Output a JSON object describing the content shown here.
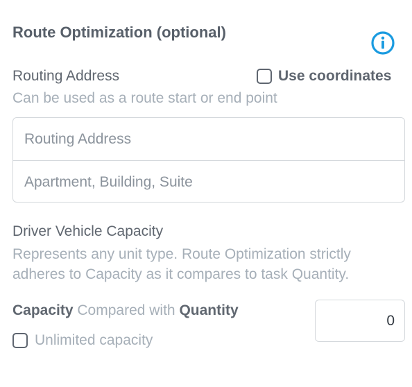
{
  "section": {
    "title": "Route Optimization (optional)",
    "info_icon": "info-circle-icon",
    "accent_color": "#1a9be0"
  },
  "routing": {
    "label": "Routing Address",
    "hint": "Can be used as a route start or end point",
    "use_coordinates_label": "Use coordinates",
    "use_coordinates_checked": false,
    "address_placeholder": "Routing Address",
    "address_value": "",
    "suite_placeholder": "Apartment, Building, Suite",
    "suite_value": ""
  },
  "capacity": {
    "label": "Driver Vehicle Capacity",
    "hint_line1": "Represents any unit type. Route Optimization strictly",
    "hint_line2": "adheres to Capacity as it compares to task Quantity.",
    "compare_bold1": "Capacity",
    "compare_middle": " Compared with ",
    "compare_bold2": "Quantity",
    "value": "0",
    "unlimited_label": "Unlimited capacity",
    "unlimited_checked": false
  }
}
